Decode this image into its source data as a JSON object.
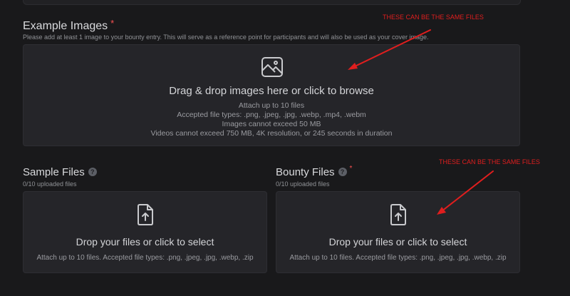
{
  "example_images": {
    "title": "Example Images",
    "required_mark": "*",
    "description": "Please add at least 1 image to your bounty entry. This will serve as a reference point for participants and will also be used as your cover image.",
    "dropzone": {
      "icon": "image-icon",
      "title": "Drag & drop images here or click to browse",
      "line1": "Attach up to 10 files",
      "line2": "Accepted file types: .png, .jpeg, .jpg, .webp, .mp4, .webm",
      "line3": "Images cannot exceed 50 MB",
      "line4": "Videos cannot exceed 750 MB, 4K resolution, or 245 seconds in duration"
    }
  },
  "sample_files": {
    "title": "Sample Files",
    "help": "?",
    "count": "0/10 uploaded files",
    "dropzone": {
      "icon": "file-upload-icon",
      "title": "Drop your files or click to select",
      "hint": "Attach up to 10 files. Accepted file types: .png, .jpeg, .jpg, .webp, .zip"
    }
  },
  "bounty_files": {
    "title": "Bounty Files",
    "help": "?",
    "required_mark": "*",
    "count": "0/10 uploaded files",
    "dropzone": {
      "icon": "file-upload-icon",
      "title": "Drop your files or click to select",
      "hint": "Attach up to 10 files. Accepted file types: .png, .jpeg, .jpg, .webp, .zip"
    }
  },
  "annotations": {
    "top": "THESE CAN BE THE SAME FILES",
    "right": "THESE CAN BE THE SAME FILES"
  },
  "colors": {
    "background": "#19191b",
    "dropzone": "#252529",
    "annotation": "#e01e1e",
    "required": "#fa5252"
  }
}
